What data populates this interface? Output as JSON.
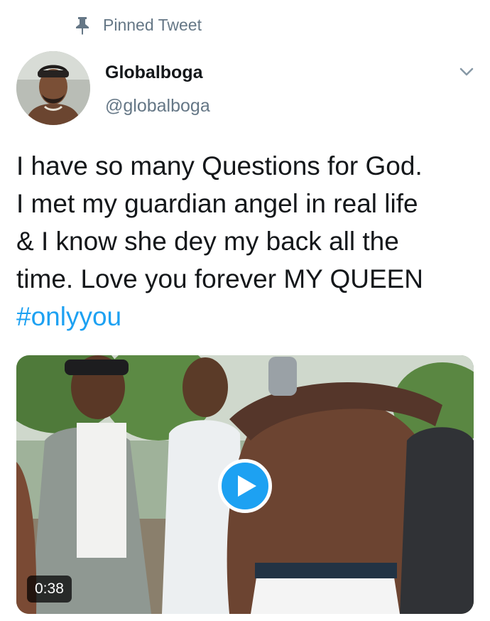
{
  "pinned": {
    "label": "Pinned Tweet",
    "icon": "pin-icon"
  },
  "author": {
    "name": "Globalboga",
    "handle": "@globalboga",
    "avatar": "avatar"
  },
  "menu": {
    "icon": "chevron-down-icon"
  },
  "tweet": {
    "lines": [
      "I have so many Questions for God.",
      "I met my guardian angel in real life",
      "& I know she dey my back all the",
      "time. Love you forever MY QUEEN"
    ],
    "hashtag": "#onlyyou"
  },
  "media": {
    "duration": "0:38",
    "play_icon": "play-icon"
  },
  "colors": {
    "accent": "#1da1f2",
    "secondary_text": "#657786",
    "primary_text": "#14171a"
  }
}
